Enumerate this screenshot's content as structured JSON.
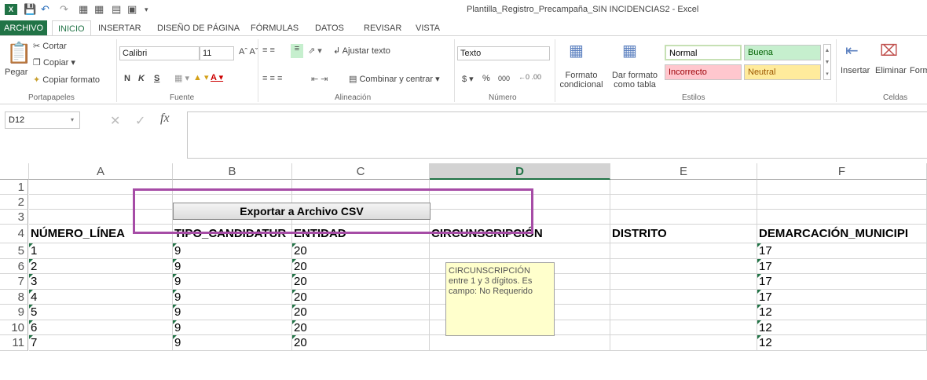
{
  "app": {
    "title": "Plantilla_Registro_Precampaña_SIN INCIDENCIAS2 - Excel",
    "logo": "X"
  },
  "tabs": [
    "ARCHIVO",
    "INICIO",
    "INSERTAR",
    "DISEÑO DE PÁGINA",
    "FÓRMULAS",
    "DATOS",
    "REVISAR",
    "VISTA"
  ],
  "ribbon": {
    "clipboard": {
      "paste": "Pegar",
      "cut": "Cortar",
      "copy": "Copiar",
      "format_painter": "Copiar formato",
      "label": "Portapapeles"
    },
    "font": {
      "name": "Calibri",
      "size": "11",
      "bold": "N",
      "italic": "K",
      "underline": "S",
      "label": "Fuente"
    },
    "alignment": {
      "wrap": "Ajustar texto",
      "merge": "Combinar y centrar",
      "label": "Alineación"
    },
    "number": {
      "format": "Texto",
      "currency": "$",
      "percent": "%",
      "thousands": "000",
      "label": "Número"
    },
    "styles": {
      "conditional": "Formato condicional",
      "as_table": "Dar formato como tabla",
      "normal": "Normal",
      "good": "Buena",
      "bad": "Incorrecto",
      "neutral": "Neutral",
      "label": "Estilos"
    },
    "cells": {
      "insert": "Insertar",
      "delete": "Eliminar",
      "format": "Form",
      "label": "Celdas"
    }
  },
  "formula_bar": {
    "name_box": "D12",
    "fx": "fx",
    "content": ""
  },
  "columns": [
    "A",
    "B",
    "C",
    "D",
    "E",
    "F"
  ],
  "rows": [
    "1",
    "2",
    "3",
    "4",
    "5",
    "6",
    "7",
    "8",
    "9",
    "10",
    "11"
  ],
  "headers": [
    "NÚMERO_LÍNEA",
    "TIPO_CANDIDATUR",
    "ENTIDAD",
    "CIRCUNSCRIPCIÓN",
    "DISTRITO",
    "DEMARCACIÓN_MUNICIPI"
  ],
  "data_rows": [
    [
      "1",
      "9",
      "20",
      "",
      "",
      "17"
    ],
    [
      "2",
      "9",
      "20",
      "",
      "",
      "17"
    ],
    [
      "3",
      "9",
      "20",
      "",
      "",
      "17"
    ],
    [
      "4",
      "9",
      "20",
      "",
      "",
      "17"
    ],
    [
      "5",
      "9",
      "20",
      "",
      "",
      "12"
    ],
    [
      "6",
      "9",
      "20",
      "",
      "",
      "12"
    ],
    [
      "7",
      "9",
      "20",
      "",
      "",
      "12"
    ]
  ],
  "export_button": "Exportar a Archivo CSV",
  "tooltip": "CIRCUNSCRIPCIÓN entre 1 y 3 dígitos. Es campo: No Requerido",
  "colors": {
    "accent": "#217346",
    "highlight": "#a64ca6",
    "tooltip_bg": "#ffffcc"
  }
}
